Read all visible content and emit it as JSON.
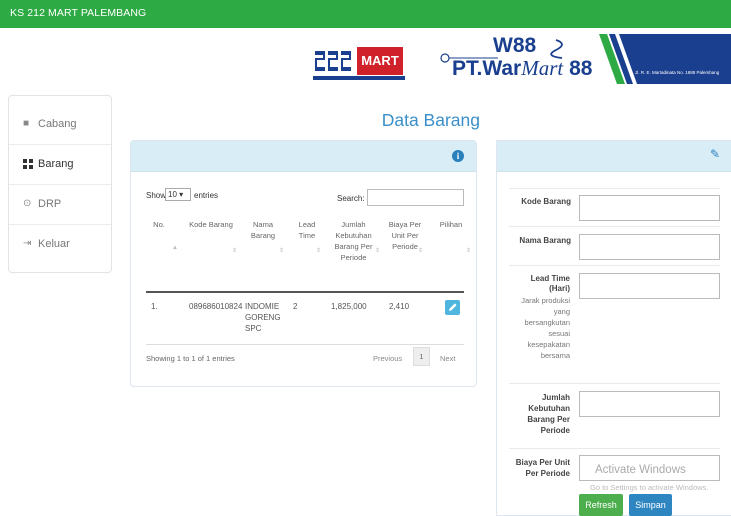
{
  "topbar": {
    "title": "KS 212 MART PALEMBANG"
  },
  "header": {
    "logo_212_mart": "MART",
    "logo_warmart_mark": "W88",
    "logo_warmart_pt": "PT.War",
    "logo_warmart_mart": "Mart",
    "logo_warmart_88": " 88",
    "address": "Jl. R. E. Martadinata No. 1888 Palembang"
  },
  "sidebar": {
    "items": [
      {
        "label": "Cabang",
        "icon": "square-icon"
      },
      {
        "label": "Barang",
        "icon": "grid-icon"
      },
      {
        "label": "DRP",
        "icon": "target-icon"
      },
      {
        "label": "Keluar",
        "icon": "logout-icon"
      }
    ]
  },
  "page": {
    "title": "Data Barang"
  },
  "table": {
    "show_label": "Show",
    "show_value": "10",
    "entries_label": "entries",
    "search_label": "Search:",
    "columns": [
      "No.",
      "Kode Barang",
      "Nama Barang",
      "Lead Time",
      "Jumlah Kebutuhan Barang Per Periode",
      "Biaya Per Unit Per Periode",
      "Pilihan"
    ],
    "rows": [
      {
        "no": "1.",
        "kode": "089686010824",
        "nama": "INDOMIE GORENG SPC",
        "lead": "2",
        "jumlah": "1,825,000",
        "biaya": "2,410"
      }
    ],
    "info": "Showing 1 to 1 of 1 entries",
    "previous": "Previous",
    "page_num": "1",
    "next": "Next"
  },
  "form": {
    "kode_label": "Kode Barang",
    "nama_label": "Nama Barang",
    "lead_label": "Lead Time (Hari)",
    "lead_help": "Jarak produksi yang bersangkutan sesuai kesepakatan bersama",
    "jumlah_label": "Jumlah Kebutuhan Barang Per Periode",
    "biaya_label": "Biaya Per Unit Per Periode",
    "refresh": "Refresh",
    "save": "Simpan"
  },
  "watermark": {
    "title": "Activate Windows",
    "subtitle": "Go to Settings to activate Windows."
  },
  "colors": {
    "topbar": "#2eaa45",
    "panel_header": "#d9edf7",
    "title_blue": "#3a8fc9",
    "refresh_green": "#4cae4c",
    "save_blue": "#2e86c1"
  }
}
